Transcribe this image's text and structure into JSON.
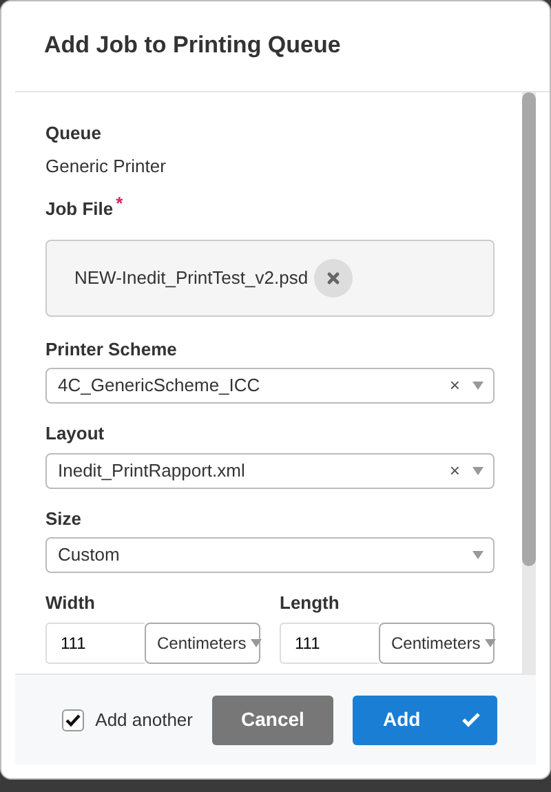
{
  "dialog": {
    "title": "Add Job to Printing Queue"
  },
  "fields": [
    {
      "kind": "text",
      "label": "Queue",
      "value": "Generic Printer"
    },
    {
      "kind": "file",
      "label": "Job File",
      "required_mark": "*",
      "value": "NEW-Inedit_PrintTest_v2.psd"
    },
    {
      "kind": "select",
      "label": "Printer Scheme",
      "value": "4C_GenericScheme_ICC",
      "clear": "×"
    },
    {
      "kind": "select",
      "label": "Layout",
      "value": "Inedit_PrintRapport.xml",
      "clear": "×"
    },
    {
      "kind": "select",
      "label": "Size",
      "value": "Custom"
    },
    {
      "kind": "pair",
      "items": [
        {
          "label": "Width",
          "value": "111",
          "unit": "Centimeters"
        },
        {
          "label": "Length",
          "value": "111",
          "unit": "Centimeters"
        }
      ]
    }
  ],
  "footer": {
    "add_another": {
      "label": "Add another",
      "checked": true
    },
    "buttons": [
      {
        "kind": "secondary",
        "label": "Cancel"
      },
      {
        "kind": "primary",
        "label": "Add"
      }
    ]
  }
}
